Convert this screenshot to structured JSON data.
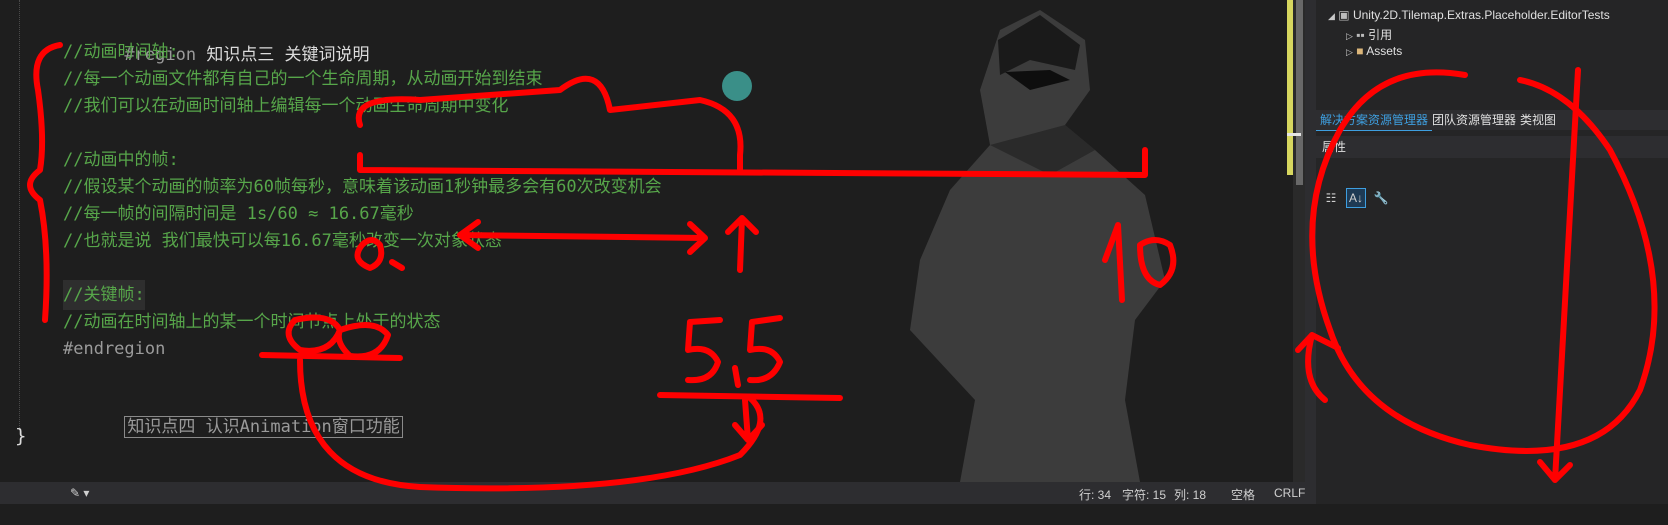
{
  "editor": {
    "lines": [
      {
        "kind": "region",
        "kw": "#region",
        "text": " 知识点三 关键词说明"
      },
      {
        "kind": "comment",
        "text": "//动画时间轴:"
      },
      {
        "kind": "comment",
        "text": "//每一个动画文件都有自己的一个生命周期，从动画开始到结束"
      },
      {
        "kind": "comment",
        "text": "//我们可以在动画时间轴上编辑每一个动画生命周期中变化"
      },
      {
        "kind": "blank",
        "text": ""
      },
      {
        "kind": "comment",
        "text": "//动画中的帧:"
      },
      {
        "kind": "comment",
        "text": "//假设某个动画的帧率为60帧每秒，意味着该动画1秒钟最多会有60次改变机会"
      },
      {
        "kind": "comment",
        "text": "//每一帧的间隔时间是 1s/60 ≈ 16.67毫秒"
      },
      {
        "kind": "comment",
        "text": "//也就是说 我们最快可以每16.67毫秒改变一次对象状态"
      },
      {
        "kind": "blank",
        "text": ""
      },
      {
        "kind": "comment",
        "text": "//关键帧:"
      },
      {
        "kind": "comment",
        "text": "//动画在时间轴上的某一个时间节点上处于的状态"
      },
      {
        "kind": "region",
        "kw": "#endregion",
        "text": ""
      },
      {
        "kind": "blank",
        "text": ""
      },
      {
        "kind": "boxed",
        "text": "知识点四 认识Animation窗口功能"
      }
    ],
    "closing_brace": "}"
  },
  "status": {
    "line": "行: 34",
    "char": "字符: 15",
    "col": "列: 18",
    "space": "空格",
    "eol": "CRLF"
  },
  "solution": {
    "project": "Unity.2D.Tilemap.Extras.Placeholder.EditorTests",
    "references": "引用",
    "assets": "Assets"
  },
  "tabs": [
    "解决方案资源管理器",
    "团队资源管理器",
    "类视图"
  ],
  "properties": {
    "title": "属性"
  },
  "annotations": [
    "10",
    "0.D",
    "0.D",
    "5,5"
  ],
  "colors": {
    "comment": "#57a64a",
    "ink": "#ff0000",
    "accent": "#3e9fe0"
  }
}
